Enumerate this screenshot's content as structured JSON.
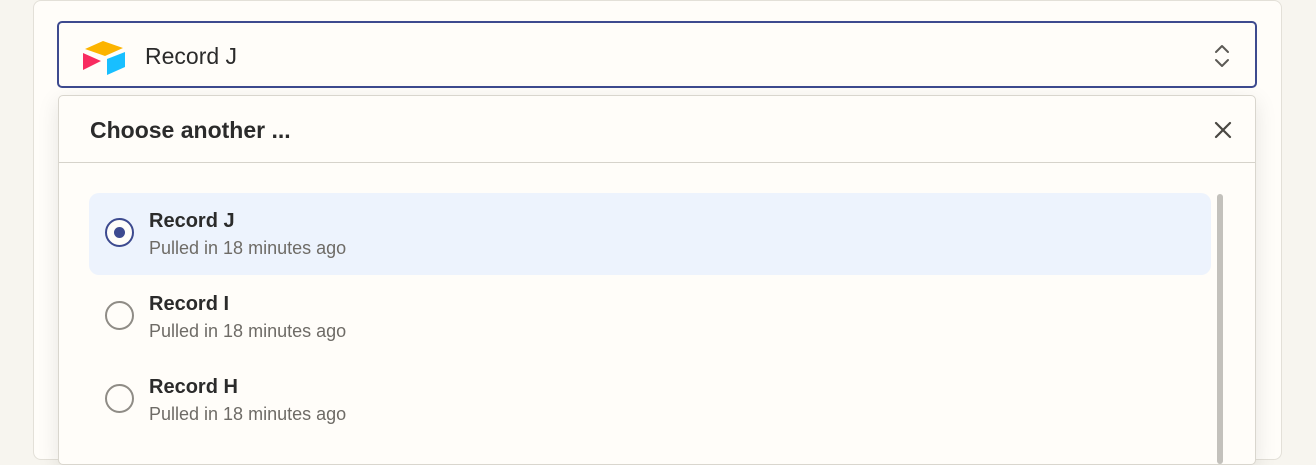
{
  "select": {
    "value": "Record J",
    "app_icon": "airtable-logo-icon",
    "toggle_icon": "chevron-up-down-icon"
  },
  "dropdown": {
    "title": "Choose another ...",
    "close_icon": "close-icon",
    "items": [
      {
        "title": "Record J",
        "subtitle": "Pulled in 18 minutes ago",
        "selected": true
      },
      {
        "title": "Record I",
        "subtitle": "Pulled in 18 minutes ago",
        "selected": false
      },
      {
        "title": "Record H",
        "subtitle": "Pulled in 18 minutes ago",
        "selected": false
      }
    ]
  },
  "colors": {
    "accent": "#3d4a8f",
    "selected_bg": "#edf3fd",
    "page_bg": "#fffdf9"
  }
}
